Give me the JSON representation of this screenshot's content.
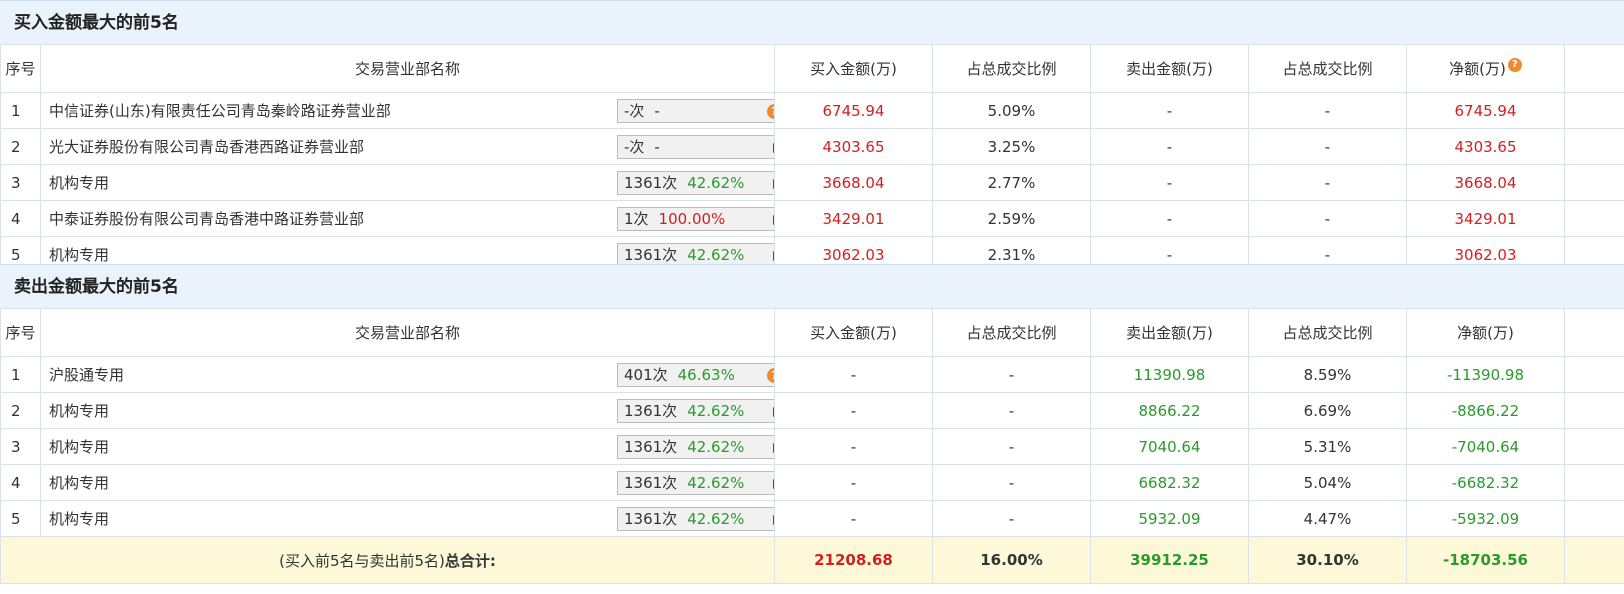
{
  "buy": {
    "title": "买入金额最大的前5名",
    "headers": [
      "序号",
      "交易营业部名称",
      "买入金额(万)",
      "占总成交比例",
      "卖出金额(万)",
      "占总成交比例",
      "净额(万)"
    ],
    "rows": [
      {
        "idx": "1",
        "name": "中信证券(山东)有限责任公司青岛秦岭路证券营业部",
        "count": "-次",
        "pct": "-",
        "icon": "question-icon",
        "buy": "6745.94",
        "buy_ratio": "5.09%",
        "sell": "-",
        "sell_ratio": "-",
        "net": "6745.94"
      },
      {
        "idx": "2",
        "name": "光大证券股份有限公司青岛香港西路证券营业部",
        "count": "-次",
        "pct": "-",
        "icon": "arrow-right-icon",
        "buy": "4303.65",
        "buy_ratio": "3.25%",
        "sell": "-",
        "sell_ratio": "-",
        "net": "4303.65"
      },
      {
        "idx": "3",
        "name": "机构专用",
        "count": "1361次",
        "pct": "42.62%",
        "icon": "arrow-right-icon",
        "buy": "3668.04",
        "buy_ratio": "2.77%",
        "sell": "-",
        "sell_ratio": "-",
        "net": "3668.04"
      },
      {
        "idx": "4",
        "name": "中泰证券股份有限公司青岛香港中路证券营业部",
        "count": "1次",
        "pct": "100.00%",
        "icon": "arrow-right-icon",
        "buy": "3429.01",
        "buy_ratio": "2.59%",
        "sell": "-",
        "sell_ratio": "-",
        "net": "3429.01"
      },
      {
        "idx": "5",
        "name": "机构专用",
        "count": "1361次",
        "pct": "42.62%",
        "icon": "arrow-right-icon",
        "buy": "3062.03",
        "buy_ratio": "2.31%",
        "sell": "-",
        "sell_ratio": "-",
        "net": "3062.03"
      }
    ]
  },
  "sell": {
    "title": "卖出金额最大的前5名",
    "headers": [
      "序号",
      "交易营业部名称",
      "买入金额(万)",
      "占总成交比例",
      "卖出金额(万)",
      "占总成交比例",
      "净额(万)"
    ],
    "rows": [
      {
        "idx": "1",
        "name": "沪股通专用",
        "count": "401次",
        "pct": "46.63%",
        "icon": "question-icon",
        "buy": "-",
        "buy_ratio": "-",
        "sell": "11390.98",
        "sell_ratio": "8.59%",
        "net": "-11390.98"
      },
      {
        "idx": "2",
        "name": "机构专用",
        "count": "1361次",
        "pct": "42.62%",
        "icon": "arrow-right-icon",
        "buy": "-",
        "buy_ratio": "-",
        "sell": "8866.22",
        "sell_ratio": "6.69%",
        "net": "-8866.22"
      },
      {
        "idx": "3",
        "name": "机构专用",
        "count": "1361次",
        "pct": "42.62%",
        "icon": "arrow-right-icon",
        "buy": "-",
        "buy_ratio": "-",
        "sell": "7040.64",
        "sell_ratio": "5.31%",
        "net": "-7040.64"
      },
      {
        "idx": "4",
        "name": "机构专用",
        "count": "1361次",
        "pct": "42.62%",
        "icon": "arrow-right-icon",
        "buy": "-",
        "buy_ratio": "-",
        "sell": "6682.32",
        "sell_ratio": "5.04%",
        "net": "-6682.32"
      },
      {
        "idx": "5",
        "name": "机构专用",
        "count": "1361次",
        "pct": "42.62%",
        "icon": "arrow-right-icon",
        "buy": "-",
        "buy_ratio": "-",
        "sell": "5932.09",
        "sell_ratio": "4.47%",
        "net": "-5932.09"
      }
    ]
  },
  "total": {
    "label_prefix": "(买入前5名与卖出前5名)",
    "label_bold": "总合计:",
    "buy": "21208.68",
    "buy_ratio": "16.00%",
    "sell": "39912.25",
    "sell_ratio": "30.10%",
    "net": "-18703.56"
  },
  "colors": {
    "positive": "#d22020",
    "negative": "#2a9a2a",
    "header_bg": "#eaf3fb",
    "total_bg": "#fdf8d8",
    "icon_orange": "#f08a2c",
    "arrow_blue": "#1d5a9e"
  }
}
